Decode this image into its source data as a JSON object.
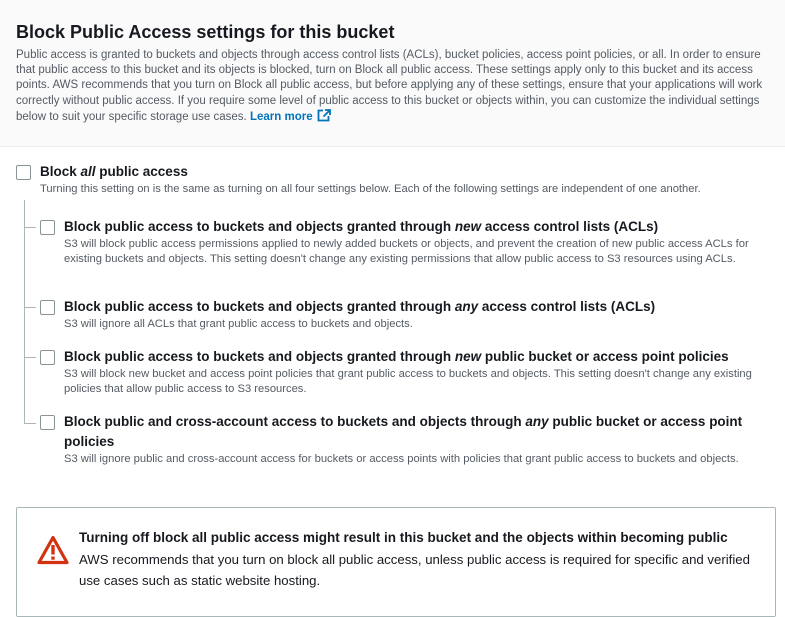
{
  "section": {
    "title": "Block Public Access settings for this bucket",
    "description": "Public access is granted to buckets and objects through access control lists (ACLs), bucket policies, access point policies, or all. In order to ensure that public access to this bucket and its objects is blocked, turn on Block all public access. These settings apply only to this bucket and its access points. AWS recommends that you turn on Block all public access, but before applying any of these settings, ensure that your applications will work correctly without public access. If you require some level of public access to this bucket or objects within, you can customize the individual settings below to suit your specific storage use cases.",
    "learn_more": "Learn more"
  },
  "block_all": {
    "title_pre": "Block ",
    "title_em": "all",
    "title_post": " public access",
    "description": "Turning this setting on is the same as turning on all four settings below. Each of the following settings are independent of one another.",
    "checked": false
  },
  "options": [
    {
      "title_pre": "Block public access to buckets and objects granted through ",
      "title_em": "new",
      "title_post": " access control lists (ACLs)",
      "description": "S3 will block public access permissions applied to newly added buckets or objects, and prevent the creation of new public access ACLs for existing buckets and objects. This setting doesn't change any existing permissions that allow public access to S3 resources using ACLs.",
      "checked": false
    },
    {
      "title_pre": "Block public access to buckets and objects granted through ",
      "title_em": "any",
      "title_post": " access control lists (ACLs)",
      "description": "S3 will ignore all ACLs that grant public access to buckets and objects.",
      "checked": false
    },
    {
      "title_pre": "Block public access to buckets and objects granted through ",
      "title_em": "new",
      "title_post": " public bucket or access point policies",
      "description": "S3 will block new bucket and access point policies that grant public access to buckets and objects. This setting doesn't change any existing policies that allow public access to S3 resources.",
      "checked": false
    },
    {
      "title_pre": "Block public and cross-account access to buckets and objects through ",
      "title_em": "any",
      "title_post": " public bucket or access point",
      "title_line2": "policies",
      "description": "S3 will ignore public and cross-account access for buckets or access points with policies that grant public access to buckets and objects.",
      "checked": false
    }
  ],
  "alert": {
    "icon": "warning-icon",
    "color": "#d13212",
    "title": "Turning off block all public access might result in this bucket and the objects within becoming public",
    "text": "AWS recommends that you turn on block all public access, unless public access is required for specific and verified use cases such as static website hosting."
  },
  "colors": {
    "link": "#0073bb",
    "secondary_text": "#545b64",
    "border": "#aab7b8"
  }
}
